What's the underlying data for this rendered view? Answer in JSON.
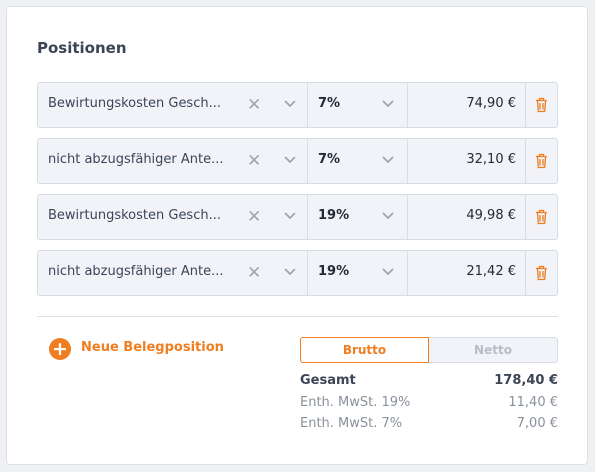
{
  "section": {
    "title": "Positionen"
  },
  "positions": [
    {
      "category": "Bewirtungskosten Gesch...",
      "tax": "7%",
      "amount": "74,90 €"
    },
    {
      "category": "nicht abzugsfähiger Ante...",
      "tax": "7%",
      "amount": "32,10 €"
    },
    {
      "category": "Bewirtungskosten Gesch...",
      "tax": "19%",
      "amount": "49,98 €"
    },
    {
      "category": "nicht abzugsfähiger Ante...",
      "tax": "19%",
      "amount": "21,42 €"
    }
  ],
  "icons": {
    "clear": "close-icon",
    "dropdown": "chevron-down-icon",
    "delete": "trash-icon",
    "add": "plus-circle-icon"
  },
  "add_button": {
    "label": "Neue Belegposition"
  },
  "toggle": {
    "brutto_label": "Brutto",
    "netto_label": "Netto",
    "selected": "Brutto"
  },
  "summary": {
    "total_label": "Gesamt",
    "total_value": "178,40 €",
    "lines": [
      {
        "label": "Enth. MwSt. 19%",
        "value": "11,40 €"
      },
      {
        "label": "Enth. MwSt. 7%",
        "value": "7,00 €"
      }
    ]
  },
  "colors": {
    "accent": "#f07d1f",
    "row_bg": "#f1f3f8",
    "border": "#d6dbe4",
    "text": "#3b4556",
    "muted": "#8a919c"
  }
}
